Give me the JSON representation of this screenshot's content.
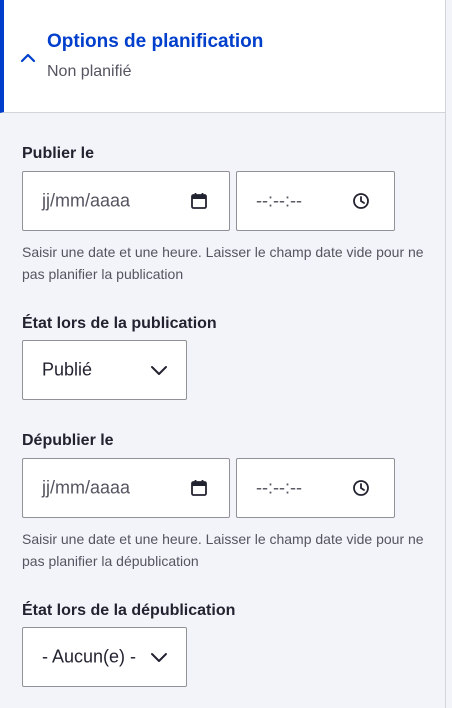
{
  "summary": {
    "title": "Options de planification",
    "subtitle": "Non planifié",
    "expanded": true
  },
  "publish": {
    "label": "Publier le",
    "date_placeholder": "jj/mm/aaaa",
    "time_placeholder": "--:--:--",
    "description": "Saisir une date et une heure. Laisser le champ date vide pour ne pas planifier la publication"
  },
  "publish_state": {
    "label": "État lors de la publication",
    "selected": "Publié"
  },
  "unpublish": {
    "label": "Dépublier le",
    "date_placeholder": "jj/mm/aaaa",
    "time_placeholder": "--:--:--",
    "description": "Saisir une date et une heure. Laisser le champ date vide pour ne pas planifier la dépublication"
  },
  "unpublish_state": {
    "label": "État lors de la dépublication",
    "selected": "- Aucun(e) -"
  },
  "colors": {
    "accent": "#003ecc",
    "background": "#f3f4f9",
    "border": "#919297"
  }
}
